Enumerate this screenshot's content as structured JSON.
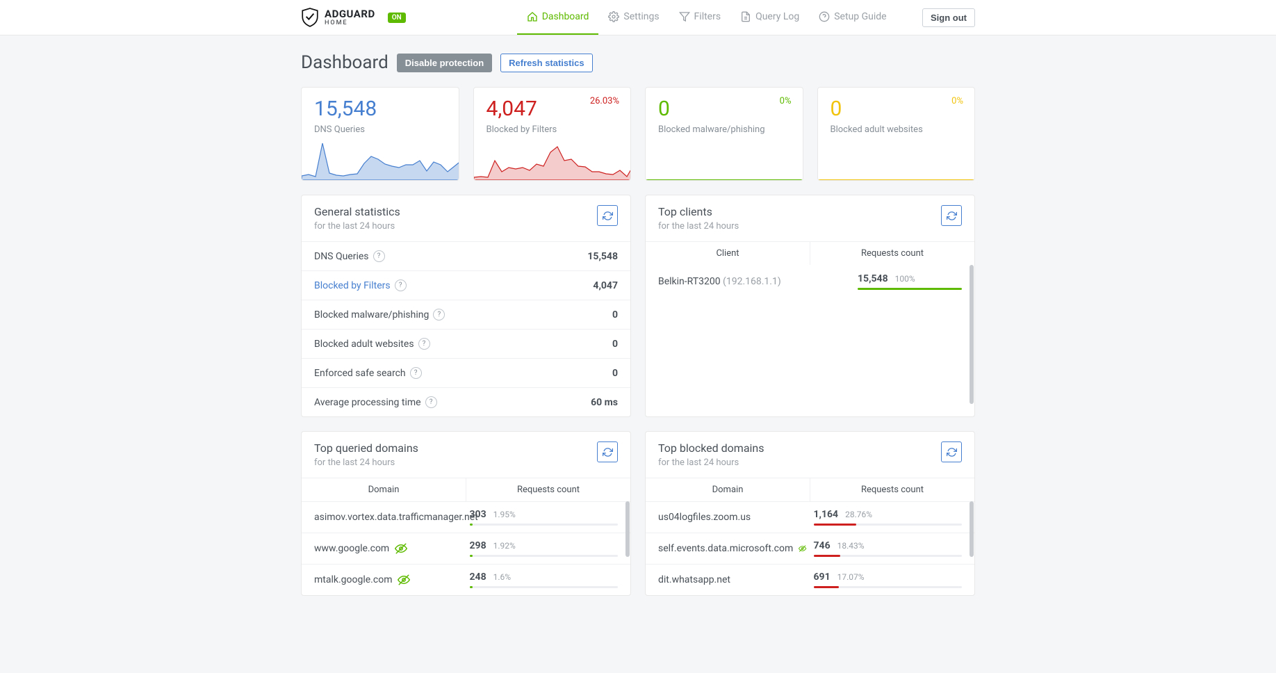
{
  "header": {
    "brand": "ADGUARD",
    "brand_sub": "HOME",
    "status_badge": "ON",
    "nav": {
      "dashboard": "Dashboard",
      "settings": "Settings",
      "filters": "Filters",
      "query_log": "Query Log",
      "setup_guide": "Setup Guide"
    },
    "sign_out": "Sign out"
  },
  "page": {
    "title": "Dashboard",
    "disable_btn": "Disable protection",
    "refresh_btn": "Refresh statistics"
  },
  "stats": {
    "dns": {
      "value": "15,548",
      "label": "DNS Queries"
    },
    "blocked": {
      "value": "4,047",
      "label": "Blocked by Filters",
      "pct": "26.03%"
    },
    "malware": {
      "value": "0",
      "label": "Blocked malware/phishing",
      "pct": "0%"
    },
    "adult": {
      "value": "0",
      "label": "Blocked adult websites",
      "pct": "0%"
    }
  },
  "chart_data": [
    {
      "type": "area",
      "title": "DNS Queries",
      "values": [
        5,
        6,
        4,
        48,
        8,
        6,
        5,
        7,
        8,
        22,
        32,
        28,
        20,
        18,
        16,
        20,
        20,
        26,
        12,
        24,
        20,
        10,
        18,
        26
      ],
      "color": "#467fcf"
    },
    {
      "type": "area",
      "title": "Blocked by Filters",
      "values": [
        2,
        3,
        2,
        20,
        7,
        12,
        11,
        13,
        9,
        16,
        14,
        30,
        36,
        20,
        22,
        14,
        13,
        8,
        8,
        6,
        5,
        10,
        3,
        16
      ],
      "color": "#cd201f"
    }
  ],
  "general": {
    "title": "General statistics",
    "subtitle": "for the last 24 hours",
    "rows": {
      "dns_queries": {
        "label": "DNS Queries",
        "value": "15,548"
      },
      "blocked_filters": {
        "label": "Blocked by Filters",
        "value": "4,047"
      },
      "malware": {
        "label": "Blocked malware/phishing",
        "value": "0"
      },
      "adult": {
        "label": "Blocked adult websites",
        "value": "0"
      },
      "safe_search": {
        "label": "Enforced safe search",
        "value": "0"
      },
      "avg_time": {
        "label": "Average processing time",
        "value": "60 ms"
      }
    }
  },
  "top_clients": {
    "title": "Top clients",
    "subtitle": "for the last 24 hours",
    "col_client": "Client",
    "col_requests": "Requests count",
    "rows": [
      {
        "name": "Belkin-RT3200",
        "ip": "(192.168.1.1)",
        "count": "15,548",
        "pct": "100%",
        "bar": 100
      }
    ]
  },
  "top_queried": {
    "title": "Top queried domains",
    "subtitle": "for the last 24 hours",
    "col_domain": "Domain",
    "col_requests": "Requests count",
    "rows": [
      {
        "domain": "asimov.vortex.data.trafficmanager.net",
        "count": "303",
        "pct": "1.95%",
        "bar": 2,
        "tracker": false
      },
      {
        "domain": "www.google.com",
        "count": "298",
        "pct": "1.92%",
        "bar": 2,
        "tracker": true
      },
      {
        "domain": "mtalk.google.com",
        "count": "248",
        "pct": "1.6%",
        "bar": 2,
        "tracker": true
      }
    ]
  },
  "top_blocked": {
    "title": "Top blocked domains",
    "subtitle": "for the last 24 hours",
    "col_domain": "Domain",
    "col_requests": "Requests count",
    "rows": [
      {
        "domain": "us04logfiles.zoom.us",
        "count": "1,164",
        "pct": "28.76%",
        "bar": 29,
        "tracker": false
      },
      {
        "domain": "self.events.data.microsoft.com",
        "count": "746",
        "pct": "18.43%",
        "bar": 18,
        "tracker": true
      },
      {
        "domain": "dit.whatsapp.net",
        "count": "691",
        "pct": "17.07%",
        "bar": 17,
        "tracker": false
      }
    ]
  }
}
